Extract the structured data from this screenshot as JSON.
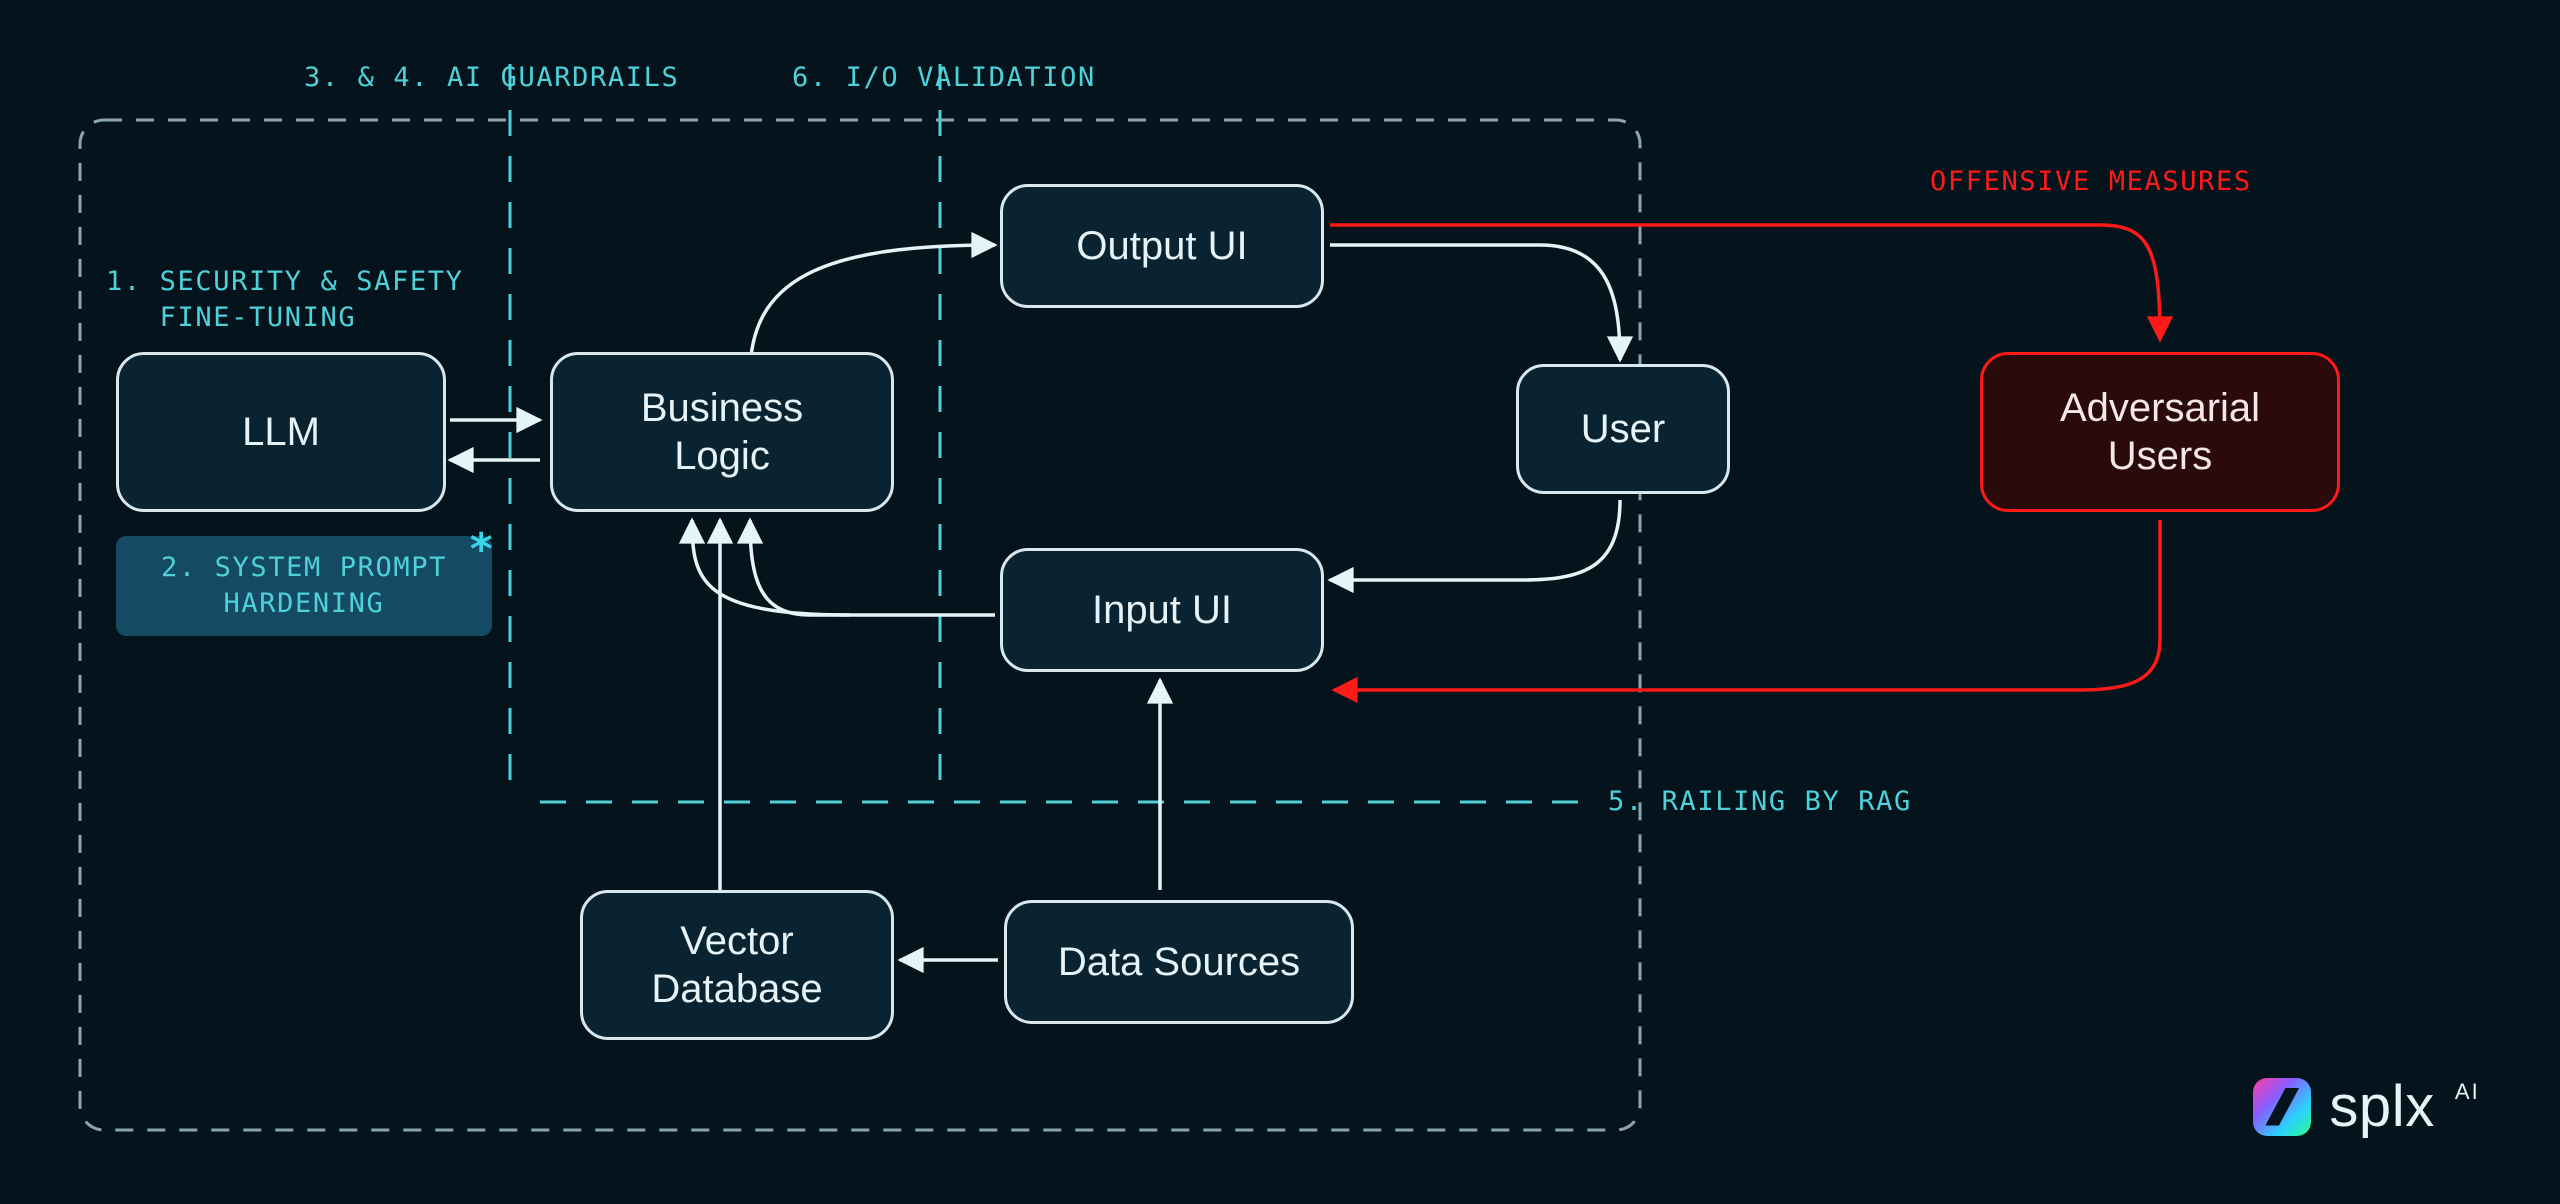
{
  "labels": {
    "step1": "1. SECURITY & SAFETY\n   FINE-TUNING",
    "step2": "2. SYSTEM PROMPT\nHARDENING",
    "step34": "3. & 4. AI GUARDRAILS",
    "step5": "5. RAILING BY RAG",
    "step6": "6. I/O VALIDATION",
    "offensive": "OFFENSIVE MEASURES"
  },
  "nodes": {
    "llm": "LLM",
    "business_logic": "Business\nLogic",
    "output_ui": "Output UI",
    "input_ui": "Input UI",
    "user": "User",
    "adversarial_users": "Adversarial\nUsers",
    "vector_database": "Vector\nDatabase",
    "data_sources": "Data Sources"
  },
  "logo": {
    "word": "splx",
    "suffix": "AI"
  },
  "colors": {
    "node_border": "#d8e8ee",
    "node_fill": "#0a2330",
    "teal_text": "#4fd1d9",
    "teal_line": "#4fd1d9",
    "red": "#ff1a1a",
    "arrow": "#e6f3f7"
  },
  "diagram_meta": {
    "description": "LLM application security architecture diagram showing defensive layers and adversarial attack paths.",
    "edges": [
      {
        "from": "LLM",
        "to": "Business Logic",
        "style": "bidirectional"
      },
      {
        "from": "Business Logic",
        "to": "Output UI",
        "style": "arrow"
      },
      {
        "from": "Input UI",
        "to": "Business Logic",
        "style": "arrow"
      },
      {
        "from": "Output UI",
        "to": "User",
        "style": "arrow"
      },
      {
        "from": "User",
        "to": "Input UI",
        "style": "arrow"
      },
      {
        "from": "Data Sources",
        "to": "Vector Database",
        "style": "arrow"
      },
      {
        "from": "Data Sources",
        "to": "Input UI",
        "style": "arrow"
      },
      {
        "from": "Vector Database",
        "to": "Business Logic",
        "style": "arrow"
      },
      {
        "from": "Output UI",
        "to": "Adversarial Users",
        "style": "red",
        "via": "OFFENSIVE MEASURES"
      },
      {
        "from": "Adversarial Users",
        "to": "Input UI",
        "style": "red"
      }
    ],
    "guard_lines": [
      {
        "label": "3. & 4. AI GUARDRAILS",
        "orientation": "vertical"
      },
      {
        "label": "6. I/O VALIDATION",
        "orientation": "vertical"
      },
      {
        "label": "5. RAILING BY RAG",
        "orientation": "horizontal"
      }
    ]
  }
}
